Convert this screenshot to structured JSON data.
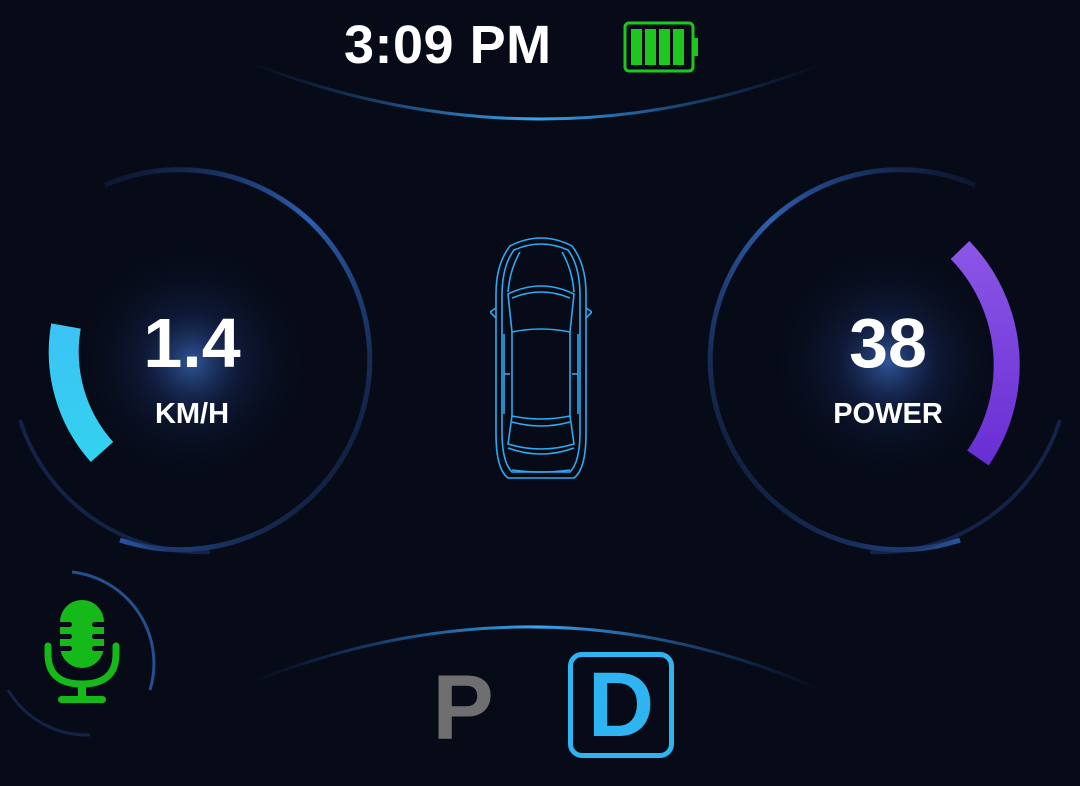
{
  "status_bar": {
    "time": "3:09 PM",
    "battery_icon": "battery-full-icon",
    "battery_color": "#1ec71e"
  },
  "speed_gauge": {
    "value": "1.4",
    "unit": "KM/H",
    "arc_color": "#3cc3f5"
  },
  "power_gauge": {
    "value": "38",
    "unit": "POWER",
    "arc_color": "#7c3fe0"
  },
  "vehicle": {
    "icon": "car-top-view-icon",
    "outline_color": "#2fa9ee"
  },
  "voice": {
    "icon": "microphone-icon",
    "color": "#16b91a"
  },
  "gears": {
    "park_label": "P",
    "drive_label": "D",
    "selected": "D",
    "selected_color": "#2fb4f2",
    "inactive_color": "#6f6f6f"
  },
  "colors": {
    "background": "#070b18",
    "accent_blue": "#2f8fe0"
  }
}
